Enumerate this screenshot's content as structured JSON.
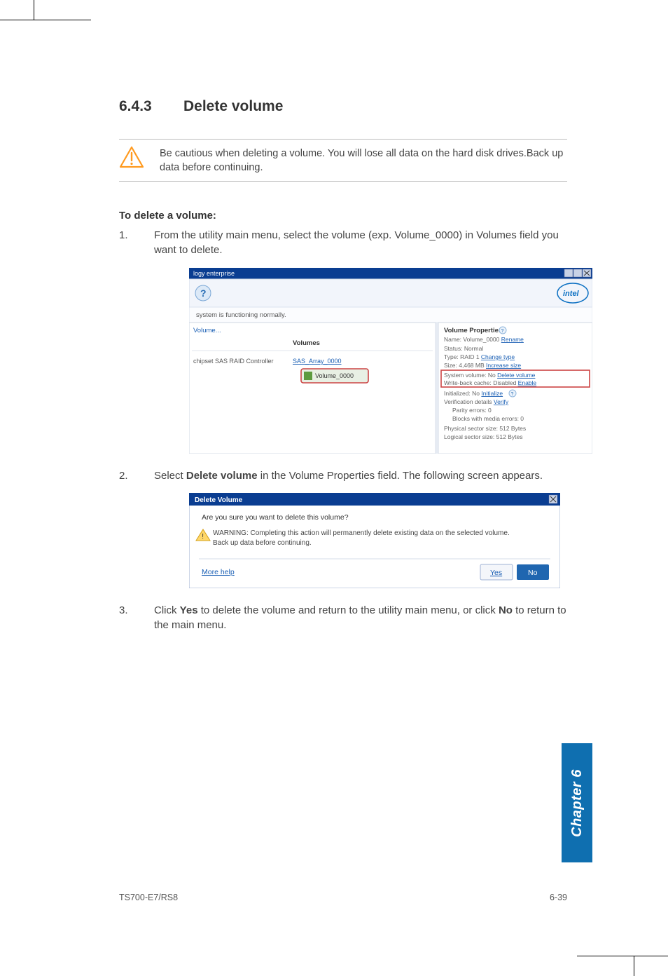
{
  "section": {
    "number": "6.4.3",
    "title": "Delete volume"
  },
  "warning": "Be cautious when deleting a volume. You will lose all data on the hard disk drives.Back up data before continuing.",
  "subheading": "To delete a volume:",
  "steps": {
    "s1": {
      "n": "1.",
      "text": "From the utility main menu, select the volume (exp. Volume_0000) in Volumes field you want to delete."
    },
    "s2": {
      "n": "2.",
      "pre": "Select ",
      "bold": "Delete volume",
      "post": " in the Volume Properties field. The following screen appears."
    },
    "s3": {
      "n": "3.",
      "pre": "Click ",
      "b1": "Yes",
      "mid": " to delete the volume and return to the utility main menu, or click ",
      "b2": "No",
      "post": " to return to the main menu."
    }
  },
  "screenshot1": {
    "titlebar": "logy enterprise",
    "status_row": "system is functioning normally.",
    "left": {
      "create": "Volume...",
      "col_header": "Volumes",
      "controller": "chipset SAS RAID Controller",
      "array": "SAS_Array_0000",
      "volume": "Volume_0000"
    },
    "right": {
      "header": "Volume Properties",
      "name_label": "Name: Volume_0000 ",
      "name_link": "Rename",
      "status": "Status: Normal",
      "type_label": "Type: RAID 1 ",
      "type_link": "Change type",
      "size_label": "Size: 4,468 MB ",
      "size_link": "Increase size",
      "sysvol_label": "System volume: No ",
      "sysvol_link": "Delete volume",
      "wbc_label": "Write-back cache: Disabled ",
      "wbc_link": "Enable",
      "init_label": "Initialized: No ",
      "init_link": "Initialize",
      "verif_label": "Verification details ",
      "verif_link": "Verify",
      "parity": "Parity errors: 0",
      "blocks": "Blocks with media errors: 0",
      "phys": "Physical sector size: 512 Bytes",
      "logi": "Logical sector size: 512 Bytes"
    }
  },
  "screenshot2": {
    "title": "Delete Volume",
    "q": "Are you sure you want to delete this volume?",
    "warn": "WARNING: Completing this action will permanently delete existing data on the selected volume. Back up data before continuing.",
    "more": "More help",
    "yes": "Yes",
    "no": "No"
  },
  "sidetab": "Chapter 6",
  "footer": {
    "model": "TS700-E7/RS8",
    "page": "6-39"
  }
}
